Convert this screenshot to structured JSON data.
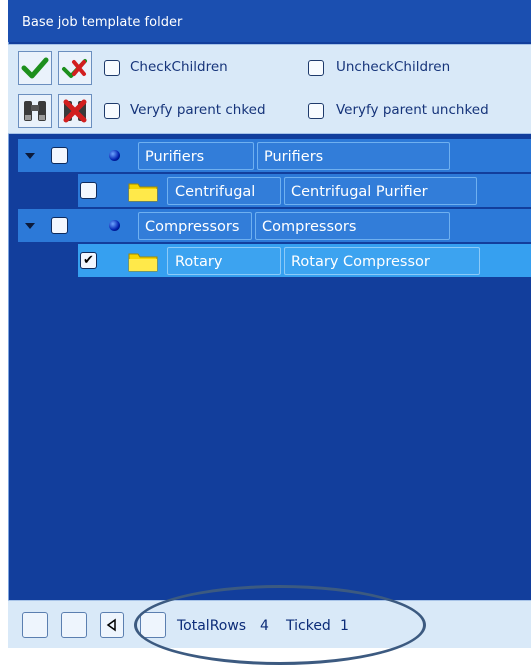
{
  "window": {
    "title": "Base job template folder"
  },
  "toolbar": {
    "check_children_label": "CheckChildren",
    "uncheck_children_label": "UncheckChildren",
    "verify_parent_checked_label": "Veryfy parent chked",
    "verify_parent_unchecked_label": "Veryfy parent unchked"
  },
  "tree": {
    "rows": [
      {
        "name": "Purifiers",
        "description": "Purifiers",
        "checked": false,
        "level": 0,
        "icon": "blue-dot-icon"
      },
      {
        "name": "Centrifugal",
        "description": "Centrifugal Purifier",
        "checked": false,
        "level": 1,
        "icon": "folder-icon"
      },
      {
        "name": "Compressors",
        "description": "Compressors",
        "checked": false,
        "level": 0,
        "icon": "blue-dot-icon"
      },
      {
        "name": "Rotary",
        "description": "Rotary Compressor",
        "checked": true,
        "level": 1,
        "icon": "folder-icon",
        "selected": true
      }
    ]
  },
  "footer": {
    "total_rows_label": "TotalRows",
    "total_rows_value": "4",
    "ticked_label": "Ticked",
    "ticked_value": "1"
  },
  "colors": {
    "panel_bg": "#123e9c",
    "row_bg": "#2c79d8",
    "selected_row_bg": "#36a0f0",
    "toolbar_bg": "#d9e9f8"
  }
}
